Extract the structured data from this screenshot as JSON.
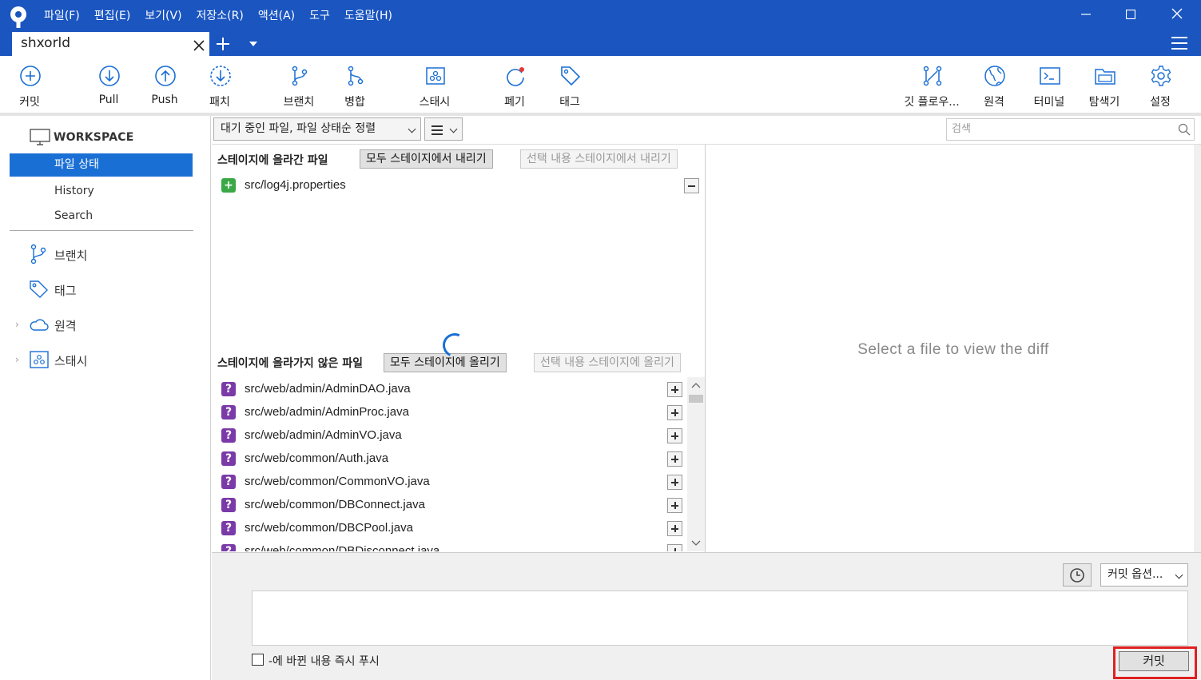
{
  "menu": [
    "파일(F)",
    "편집(E)",
    "보기(V)",
    "저장소(R)",
    "액션(A)",
    "도구",
    "도움말(H)"
  ],
  "tab": {
    "label": "shxorld"
  },
  "toolbar": {
    "commit": "커밋",
    "pull": "Pull",
    "push": "Push",
    "patch": "패치",
    "branch": "브랜치",
    "merge": "병합",
    "stash": "스태시",
    "discard": "폐기",
    "tag": "태그",
    "gitflow": "깃 플로우...",
    "remote": "원격",
    "terminal": "터미널",
    "explorer": "탐색기",
    "settings": "설정"
  },
  "sidebar": {
    "workspace": "WORKSPACE",
    "items": [
      "파일 상태",
      "History",
      "Search"
    ],
    "groups": [
      "브랜치",
      "태그",
      "원격",
      "스태시"
    ]
  },
  "filter": {
    "sort": "대기 중인 파일, 파일 상태순 정렬",
    "search_placeholder": "검색"
  },
  "staged": {
    "title": "스테이지에 올라간 파일",
    "unstage_all": "모두 스테이지에서 내리기",
    "unstage_selected": "선택 내용 스테이지에서 내리기",
    "files": [
      "src/log4j.properties"
    ]
  },
  "unstaged": {
    "title": "스테이지에 올라가지 않은 파일",
    "stage_all": "모두 스테이지에 올리기",
    "stage_selected": "선택 내용 스테이지에 올리기",
    "files": [
      "src/web/admin/AdminDAO.java",
      "src/web/admin/AdminProc.java",
      "src/web/admin/AdminVO.java",
      "src/web/common/Auth.java",
      "src/web/common/CommonVO.java",
      "src/web/common/DBConnect.java",
      "src/web/common/DBCPool.java",
      "src/web/common/DBDisconnect.java"
    ]
  },
  "diff": {
    "placeholder": "Select a file to view the diff"
  },
  "commit": {
    "options": "커밋 옵션...",
    "push_label": "-에 바뀐 내용 즉시 푸시",
    "button": "커밋"
  },
  "colors": {
    "titlebar": "#1a55c0",
    "accent": "#1a6fd4",
    "highlight": "#e02020"
  }
}
